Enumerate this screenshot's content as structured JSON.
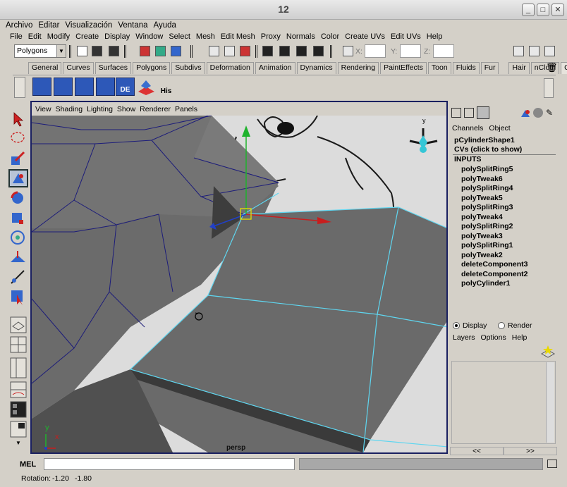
{
  "window": {
    "title": "12"
  },
  "os_menu": [
    "Archivo",
    "Editar",
    "Visualización",
    "Ventana",
    "Ayuda"
  ],
  "maya_menu": [
    "File",
    "Edit",
    "Modify",
    "Create",
    "Display",
    "Window",
    "Select",
    "Mesh",
    "Edit Mesh",
    "Proxy",
    "Normals",
    "Color",
    "Create UVs",
    "Edit UVs",
    "Help"
  ],
  "status_line": {
    "menu_set": "Polygons",
    "x_label": "X:",
    "y_label": "Y:",
    "z_label": "Z:"
  },
  "shelf_tabs": [
    "General",
    "Curves",
    "Surfaces",
    "Polygons",
    "Subdivs",
    "Deformation",
    "Animation",
    "Dynamics",
    "Rendering",
    "PaintEffects",
    "Toon",
    "Fluids",
    "Fur",
    "Hair",
    "nCloth",
    "Custom"
  ],
  "shelf_tabs_active": "Custom",
  "shelf_icon_labels": {
    "de": "DE",
    "his": "His"
  },
  "viewport": {
    "menu": [
      "View",
      "Shading",
      "Lighting",
      "Show",
      "Renderer",
      "Panels"
    ],
    "camera_label": "persp",
    "axis_y": "y",
    "axis_x": "x",
    "view_cube_y": "y",
    "colors": {
      "selected_edge": "#5fd6f0",
      "mesh_face": "#686868",
      "wire": "#1c1c7a",
      "border": "#1a2060"
    }
  },
  "channel_box": {
    "tabs": [
      "Channels",
      "Object"
    ],
    "object_name": "pCylinderShape1",
    "cvs_label": "CVs (click to show)",
    "inputs_header": "INPUTS",
    "inputs": [
      "polySplitRing5",
      "polyTweak6",
      "polySplitRing4",
      "polyTweak5",
      "polySplitRing3",
      "polyTweak4",
      "polySplitRing2",
      "polyTweak3",
      "polySplitRing1",
      "polyTweak2",
      "deleteComponent3",
      "deleteComponent2",
      "polyCylinder1"
    ]
  },
  "layer_editor": {
    "display_label": "Display",
    "render_label": "Render",
    "menu": [
      "Layers",
      "Options",
      "Help"
    ],
    "scroll_left": "<<",
    "scroll_right": ">>"
  },
  "command_line": {
    "label": "MEL",
    "value": ""
  },
  "help_line": {
    "rotation_label": "Rotation:",
    "rotation_a": "-1.20",
    "rotation_b": "-1.80"
  }
}
